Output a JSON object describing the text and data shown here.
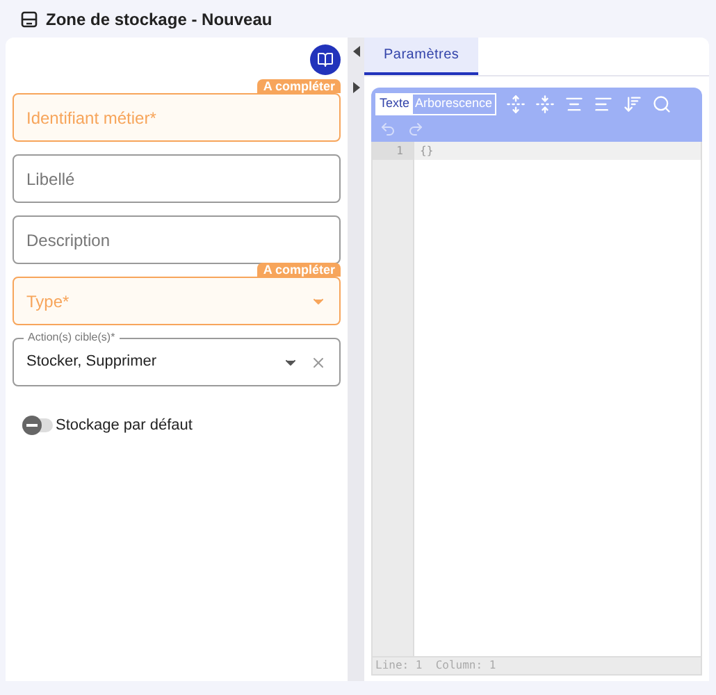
{
  "header": {
    "title": "Zone de stockage - Nouveau"
  },
  "form": {
    "fields": [
      {
        "kind": "text",
        "placeholder": "Identifiant métier*",
        "badge": "A compléter",
        "invalid": true
      },
      {
        "kind": "text",
        "placeholder": "Libellé",
        "invalid": false
      },
      {
        "kind": "text",
        "placeholder": "Description",
        "invalid": false
      },
      {
        "kind": "select",
        "placeholder": "Type*",
        "badge": "A compléter",
        "invalid": true
      },
      {
        "kind": "multiselect",
        "label": "Action(s) cible(s)*",
        "value": "Stocker, Supprimer",
        "invalid": false
      }
    ],
    "toggle": {
      "label": "Stockage par défaut",
      "on": false
    }
  },
  "tabs": [
    {
      "label": "Paramètres",
      "selected": true
    }
  ],
  "editor": {
    "modes": [
      {
        "label": "Texte",
        "selected": true
      },
      {
        "label": "Arborescence",
        "selected": false
      }
    ],
    "lines": [
      {
        "number": "1",
        "text": "{}"
      }
    ],
    "status": "Line: 1  Column: 1"
  }
}
